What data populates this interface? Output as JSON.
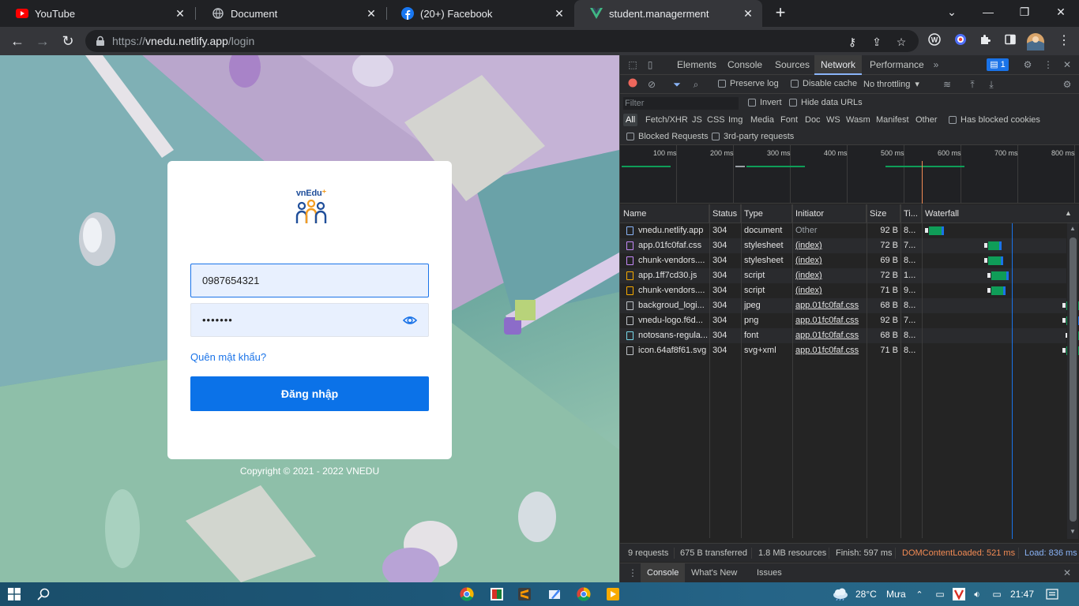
{
  "browser": {
    "tabs": [
      {
        "title": "YouTube",
        "icon": "youtube-icon"
      },
      {
        "title": "Document",
        "icon": "globe-icon"
      },
      {
        "title": "(20+) Facebook",
        "icon": "facebook-icon"
      },
      {
        "title": "student.managerment",
        "icon": "vue-icon",
        "active": true
      }
    ],
    "close_glyph": "✕",
    "new_tab_glyph": "+",
    "url_prefix": "https://",
    "url_host": "vnedu.netlify.app",
    "url_path": "/login"
  },
  "login": {
    "logo_text_1": "vnEdu",
    "logo_text_2": "⁺",
    "phone_value": "0987654321",
    "password_mask": "•••••••",
    "forgot_label": "Quên mật khẩu?",
    "submit_label": "Đăng nhập",
    "copyright": "Copyright © 2021 - 2022 VNEDU"
  },
  "devtools": {
    "tabs": [
      "Elements",
      "Console",
      "Sources",
      "Network",
      "Performance"
    ],
    "active_tab": "Network",
    "more_glyph": "»",
    "issues_count": "1",
    "preserve_log": "Preserve log",
    "disable_cache": "Disable cache",
    "throttling": "No throttling",
    "filter_placeholder": "Filter",
    "invert": "Invert",
    "hide_data_urls": "Hide data URLs",
    "types": [
      "All",
      "Fetch/XHR",
      "JS",
      "CSS",
      "Img",
      "Media",
      "Font",
      "Doc",
      "WS",
      "Wasm",
      "Manifest",
      "Other"
    ],
    "has_blocked_cookies": "Has blocked cookies",
    "blocked_requests": "Blocked Requests",
    "third_party": "3rd-party requests",
    "overview_ticks": [
      "100 ms",
      "200 ms",
      "300 ms",
      "400 ms",
      "500 ms",
      "600 ms",
      "700 ms",
      "800 ms"
    ],
    "columns": [
      "Name",
      "Status",
      "Type",
      "Initiator",
      "Size",
      "Ti...",
      "Waterfall"
    ],
    "requests": [
      {
        "name": "vnedu.netlify.app",
        "status": "304",
        "type": "document",
        "initiator": "Other",
        "size": "92 B",
        "time": "8...",
        "wf_start": 0.02,
        "wf_len": 0.055,
        "kind": "doc"
      },
      {
        "name": "app.01fc0faf.css",
        "status": "304",
        "type": "stylesheet",
        "initiator": "(index)",
        "size": "72 B",
        "time": "7...",
        "wf_start": 0.24,
        "wf_len": 0.05,
        "kind": "css"
      },
      {
        "name": "chunk-vendors....",
        "status": "304",
        "type": "stylesheet",
        "initiator": "(index)",
        "size": "69 B",
        "time": "8...",
        "wf_start": 0.24,
        "wf_len": 0.055,
        "kind": "css"
      },
      {
        "name": "app.1ff7cd30.js",
        "status": "304",
        "type": "script",
        "initiator": "(index)",
        "size": "72 B",
        "time": "1...",
        "wf_start": 0.25,
        "wf_len": 0.065,
        "kind": "js"
      },
      {
        "name": "chunk-vendors....",
        "status": "304",
        "type": "script",
        "initiator": "(index)",
        "size": "71 B",
        "time": "9...",
        "wf_start": 0.25,
        "wf_len": 0.055,
        "kind": "js"
      },
      {
        "name": "backgroud_logi...",
        "status": "304",
        "type": "jpeg",
        "initiator": "app.01fc0faf.css",
        "size": "68 B",
        "time": "8...",
        "wf_start": 0.53,
        "wf_len": 0.055,
        "kind": "img"
      },
      {
        "name": "vnedu-logo.f6d...",
        "status": "304",
        "type": "png",
        "initiator": "app.01fc0faf.css",
        "size": "92 B",
        "time": "7...",
        "wf_start": 0.53,
        "wf_len": 0.05,
        "kind": "img"
      },
      {
        "name": "notosans-regula...",
        "status": "304",
        "type": "font",
        "initiator": "app.01fc0faf.css",
        "size": "68 B",
        "time": "8...",
        "wf_start": 0.54,
        "wf_len": 0.07,
        "kind": "font"
      },
      {
        "name": "icon.64af8f61.svg",
        "status": "304",
        "type": "svg+xml",
        "initiator": "app.01fc0faf.css",
        "size": "71 B",
        "time": "8...",
        "wf_start": 0.53,
        "wf_len": 0.06,
        "kind": "img"
      }
    ],
    "summary": {
      "requests": "9 requests",
      "transferred": "675 B transferred",
      "resources": "1.8 MB resources",
      "finish": "Finish: 597 ms",
      "dcl": "DOMContentLoaded: 521 ms",
      "load": "Load: 836 ms"
    },
    "drawer_tabs": [
      "Console",
      "What's New",
      "Issues"
    ],
    "colors": {
      "dcl": "#f28b54",
      "load": "#8ab4f8",
      "bar_green": "#0f9d58",
      "bar_blue": "#1a73e8"
    }
  },
  "taskbar": {
    "temperature": "28°C",
    "weather": "Mưa",
    "time": "21:47"
  }
}
